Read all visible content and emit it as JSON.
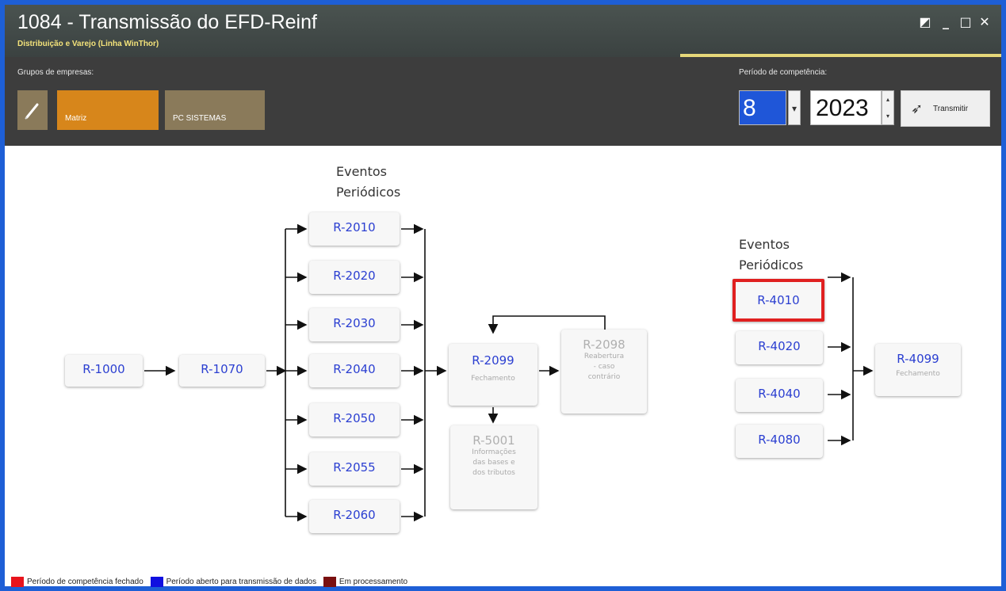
{
  "window": {
    "title": "1084 - Transmissão do EFD-Reinf",
    "subtitle": "Distribuição e Varejo (Linha WinThor)",
    "controls": {
      "maximize": "◩",
      "minimize": "_",
      "restore": "□",
      "close": "✕"
    }
  },
  "toolbar": {
    "groups_label": "Grupos de empresas:",
    "edit_icon": "pencil-icon",
    "groups": [
      "Matriz",
      "PC SISTEMAS"
    ],
    "period_label": "Período de competência:",
    "month": "8",
    "year": "2023",
    "transmit_label": "Transmitir",
    "transmit_icon": "send-icon"
  },
  "flow": {
    "left_heading": [
      "Eventos",
      "Periódicos"
    ],
    "right_heading": [
      "Eventos",
      "Periódicos"
    ],
    "start": [
      "R-1000",
      "R-1070"
    ],
    "periodic_2000": [
      "R-2010",
      "R-2020",
      "R-2030",
      "R-2040",
      "R-2050",
      "R-2055",
      "R-2060"
    ],
    "r2099": {
      "code": "R-2099",
      "desc": "Fechamento"
    },
    "r2098": {
      "code": "R-2098",
      "desc": [
        "Reabertura",
        "- caso",
        "contrário"
      ]
    },
    "r5001": {
      "code": "R-5001",
      "desc": [
        "Informações",
        "das bases e",
        "dos tributos"
      ]
    },
    "periodic_4000": [
      "R-4010",
      "R-4020",
      "R-4040",
      "R-4080"
    ],
    "r4099": {
      "code": "R-4099",
      "desc": "Fechamento"
    },
    "highlight_color": "#e02020"
  },
  "legend": [
    {
      "color": "#e8141c",
      "label": "Período de competência fechado"
    },
    {
      "color": "#1010e0",
      "label": "Período aberto para transmissão de dados"
    },
    {
      "color": "#7a1010",
      "label": "Em processamento"
    }
  ]
}
